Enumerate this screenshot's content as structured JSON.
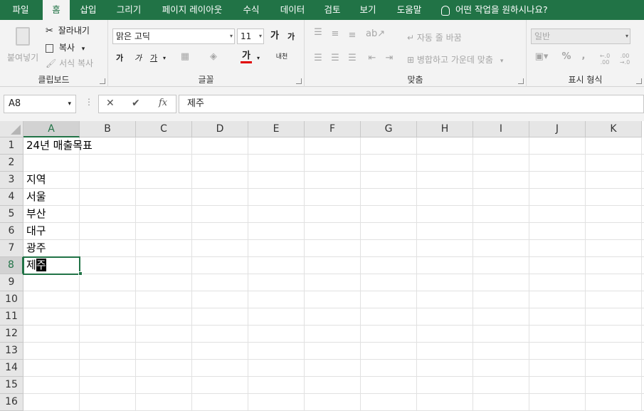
{
  "ribbon_tabs": [
    "파일",
    "홈",
    "삽입",
    "그리기",
    "페이지 레이아웃",
    "수식",
    "데이터",
    "검토",
    "보기",
    "도움말"
  ],
  "active_tab": "홈",
  "tell_me": "어떤 작업을 원하시나요?",
  "clipboard": {
    "paste": "붙여넣기",
    "cut": "잘라내기",
    "copy": "복사",
    "format_painter": "서식 복사",
    "label": "클립보드"
  },
  "font": {
    "name": "맑은 고딕",
    "size": "11",
    "grow": "가",
    "shrink": "가",
    "bold": "가",
    "italic": "가",
    "underline": "가",
    "font_color": "가",
    "phonetic": "내천",
    "label": "글꼴"
  },
  "alignment": {
    "wrap": "자동 줄 바꿈",
    "merge": "병합하고 가운데 맞춤",
    "label": "맞춤"
  },
  "number": {
    "format": "일반",
    "percent": "%",
    "comma": ",",
    "inc_dec": "←.0 .00",
    "dec_dec": ".00 →.0",
    "label": "표시 형식"
  },
  "name_box": "A8",
  "formula_bar": {
    "cancel": "✕",
    "enter": "✔",
    "fx": "fx",
    "value": "제주"
  },
  "columns": [
    "A",
    "B",
    "C",
    "D",
    "E",
    "F",
    "G",
    "H",
    "I",
    "J",
    "K"
  ],
  "rows": [
    "1",
    "2",
    "3",
    "4",
    "5",
    "6",
    "7",
    "8",
    "9",
    "10",
    "11",
    "12",
    "13",
    "14",
    "15",
    "16"
  ],
  "cells": {
    "A1": "24년 매출목표",
    "A3": "지역",
    "A4": "서울",
    "A5": "부산",
    "A6": "대구",
    "A7": "광주",
    "A8_part1": "제",
    "A8_part2": "주"
  },
  "selected_column": "A",
  "selected_row": "8",
  "colors": {
    "accent": "#217346",
    "ribbon_bg": "#f3f3f3",
    "header_bg": "#e6e6e6"
  }
}
